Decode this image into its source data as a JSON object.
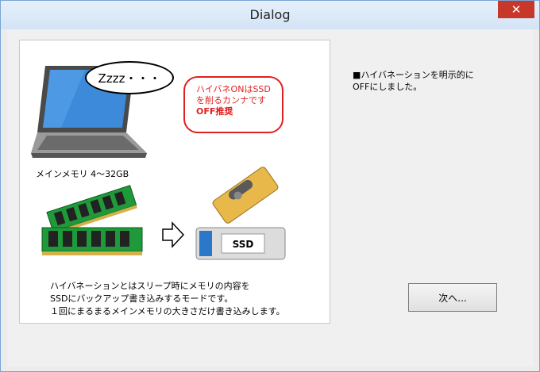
{
  "window": {
    "title": "Dialog",
    "close_glyph": "✕"
  },
  "illustration": {
    "bubble_text": "Zzzz・・・",
    "note_lines": [
      "ハイバネONはSSD",
      "を削るカンナです",
      "OFF推奨"
    ],
    "memory_caption": "メインメモリ 4～32GB",
    "ssd_label": "SSD",
    "description_lines": [
      "ハイバネーションとはスリープ時にメモリの内容を",
      "SSDにバックアップ書き込みするモードです。",
      "１回にまるまるメインメモリの大きさだけ書き込みします。"
    ]
  },
  "message": {
    "line1": "■ハイバネーションを明示的に",
    "line2": "OFFにしました。"
  },
  "buttons": {
    "next_label": "次へ..."
  },
  "colors": {
    "accent_red": "#e0201f",
    "ram_green": "#1f9a3a",
    "laptop_blue": "#2c78c8"
  }
}
